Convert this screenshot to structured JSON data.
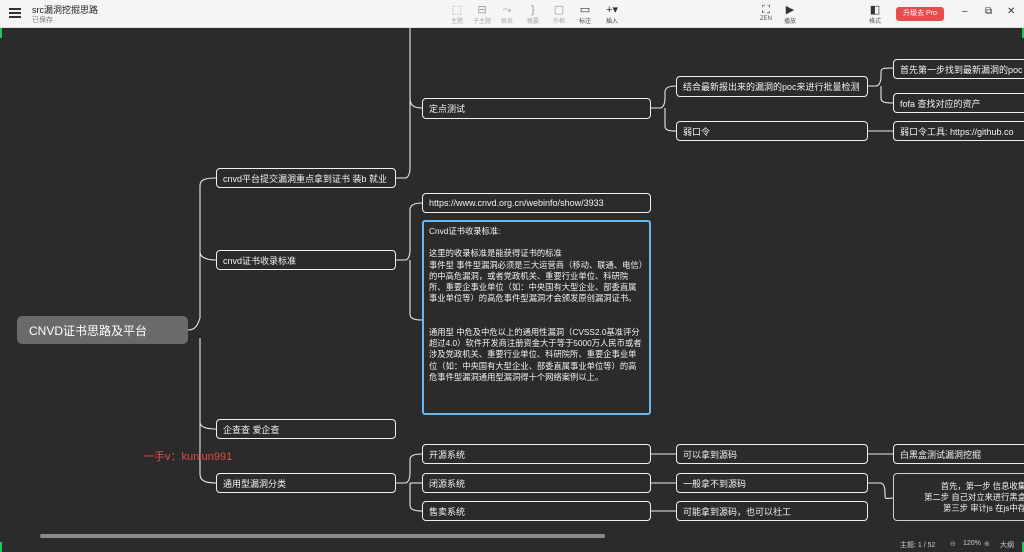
{
  "app": {
    "title": "src漏洞挖掘思路",
    "status": "已保存",
    "upgrade_label": "升级去 Pro"
  },
  "toolbar": {
    "tools": [
      {
        "label": "主题",
        "icon": "theme-icon"
      },
      {
        "label": "子主题",
        "icon": "subtopic-icon"
      },
      {
        "label": "联系",
        "icon": "relationship-icon"
      },
      {
        "label": "概要",
        "icon": "summary-icon"
      },
      {
        "label": "外框",
        "icon": "boundary-icon"
      },
      {
        "label": "标注",
        "icon": "callout-icon"
      },
      {
        "label": "插入",
        "icon": "insert-icon"
      }
    ],
    "right": [
      {
        "label": "ZEN",
        "icon": "zen-icon"
      },
      {
        "label": "播放",
        "icon": "play-icon"
      },
      {
        "label": "格式",
        "icon": "format-panel-icon"
      }
    ]
  },
  "mindmap": {
    "root": "CNVD证书思路及平台",
    "branches": {
      "b1": "cnvd平台提交漏洞重点拿到证书 装b  就业",
      "b2": "cnvd证书收录标准",
      "b3": "企查查  爱企查",
      "b4": "通用型漏洞分类"
    },
    "top": {
      "fixed_test": "定点测试",
      "poc_check": "结合最新报出来的漏洞的poc来进行批量检测",
      "find_poc": "首先第一步找到最新漏洞的poc",
      "fofa": "fofa 查找对应的资产",
      "weak_pw": "弱口令",
      "weak_tool": "弱口令工具: https://github.co"
    },
    "cnvd_url": "https://www.cnvd.org.cn/webinfo/show/3933",
    "textbox": {
      "heading": "Cnvd证书收录标准:",
      "para1": "这里的收录标准是能获得证书的标准\n事件型 事件型漏洞必须是三大运营商（移动、联通、电信）的中高危漏洞，或者党政机关、重要行业单位、科研院所、重要企事业单位（如：中央国有大型企业、部委直属事业单位等）的高危事件型漏洞才会颁发原创漏洞证书。",
      "para2": "通用型 中危及中危以上的通用性漏洞（CVSS2.0基准评分超过4.0）软件开发商注册资金大于等于5000万人民币或者涉及党政机关、重要行业单位、科研院所、重要企事业单位（如：中央国有大型企业、部委直属事业单位等）的高危事件型漏洞通用型漏洞得十个网络案例以上。"
    },
    "types": {
      "open": "开源系统",
      "closed": "闭源系统",
      "sale": "售卖系统",
      "open_child": "可以拿到源码",
      "closed_child": "一般拿不到源码",
      "sale_child": "可能拿到源码，也可以社工",
      "whitebox": "白黑盒测试漏洞挖掘",
      "steps": [
        "首先，第一步 信息收集",
        "第二步 自己对立来进行黑盒",
        "第三步 审计js 在js中存"
      ]
    }
  },
  "watermark": "一手v：kunlun991",
  "statusbar": {
    "topic_count": "主题: 1 / 52",
    "zoom": "120%",
    "outline": "大纲"
  },
  "colors": {
    "canvas_bg": "#2b2b2b",
    "node_border": "#f0f0f0",
    "selection": "#67b7f0",
    "pro_button": "#e84c4c",
    "watermark": "#e24a4a",
    "root_bg": "#6a6a6a"
  }
}
